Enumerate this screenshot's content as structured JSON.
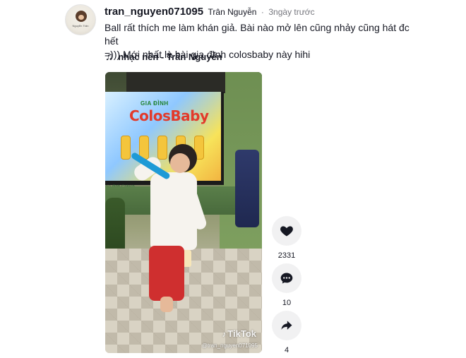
{
  "author": {
    "username": "tran_nguyen071095",
    "nickname": "Trân Nguyễn",
    "separator": "·",
    "posted": "3ngày trước",
    "avatar_caption": "Nguyễn Trân"
  },
  "post": {
    "caption": "Ball rất thích me làm khán giả. Bài nào mở lên cũng nhảy cũng hát đc hết\n=))) Mới nhất là bài gia đình colosbaby này hihi"
  },
  "music": {
    "icon": "music-note-icon",
    "label": "nhạc nền - Trân Nguyễn"
  },
  "video": {
    "tv_small": "GIA ĐÌNH",
    "tv_brand": "ColosBaby",
    "tv_footer": "gia đình Colosb",
    "watermark": "TikTok",
    "watermark_handle": "@tran_nguyen071095"
  },
  "actions": {
    "likes": "2331",
    "comments": "10",
    "shares": "4"
  },
  "colors": {
    "text_primary": "#161823",
    "action_bg": "#f1f1f2"
  }
}
